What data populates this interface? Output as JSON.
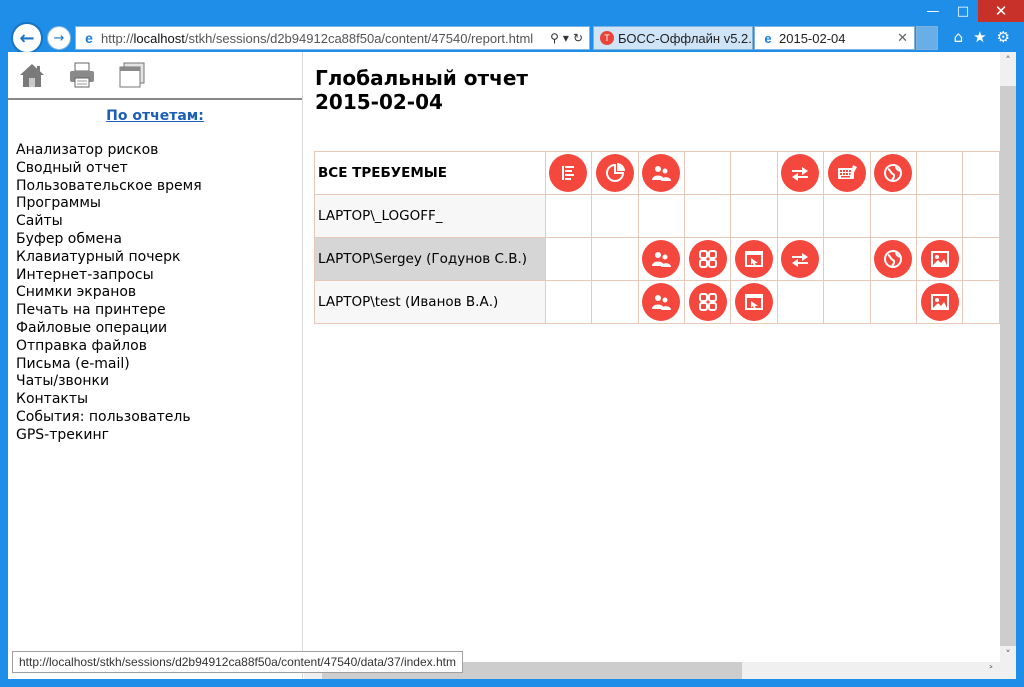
{
  "browser": {
    "address_url_prefix": "http://",
    "address_url_host": "localhost",
    "address_url_path": "/stkh/sessions/d2b94912ca88f50a/content/47540/report.html",
    "tabs": [
      {
        "label": "БОСС-Оффлайн v5.2...",
        "active": false
      },
      {
        "label": "2015-02-04",
        "active": true
      }
    ],
    "status_url": "http://localhost/stkh/sessions/d2b94912ca88f50a/content/47540/data/37/index.htm"
  },
  "left": {
    "link": "По отчетам:",
    "menu": [
      "Анализатор рисков",
      "Сводный отчет",
      "Пользовательское время",
      "Программы",
      "Сайты",
      "Буфер обмена",
      "Клавиатурный почерк",
      "Интернет-запросы",
      "Снимки экранов",
      "Печать на принтере",
      "Файловые операции",
      "Отправка файлов",
      "Письма (e-mail)",
      "Чаты/звонки",
      "Контакты",
      "События: пользователь",
      "GPS-трекинг"
    ]
  },
  "report": {
    "title_line1": "Глобальный отчет",
    "title_line2": "2015-02-04",
    "rows": [
      {
        "label": "ВСЕ ТРЕБУЕМЫЕ",
        "cells": [
          "list",
          "pie",
          "users",
          "",
          "",
          "transfer",
          "keyboard",
          "globe",
          "",
          ""
        ]
      },
      {
        "label": "LAPTOP\\_LOGOFF_",
        "cells": [
          "",
          "",
          "",
          "",
          "",
          "",
          "",
          "",
          "",
          ""
        ]
      },
      {
        "label": "LAPTOP\\Sergey (Годунов С.В.)",
        "cells": [
          "",
          "",
          "users",
          "apps",
          "window",
          "transfer",
          "",
          "globe",
          "image",
          ""
        ]
      },
      {
        "label": "LAPTOP\\test (Иванов В.А.)",
        "cells": [
          "",
          "",
          "users",
          "apps",
          "window",
          "",
          "",
          "",
          "image",
          ""
        ]
      }
    ]
  },
  "colors": {
    "accent": "#1e8ee9",
    "badge": "#f4473d"
  }
}
